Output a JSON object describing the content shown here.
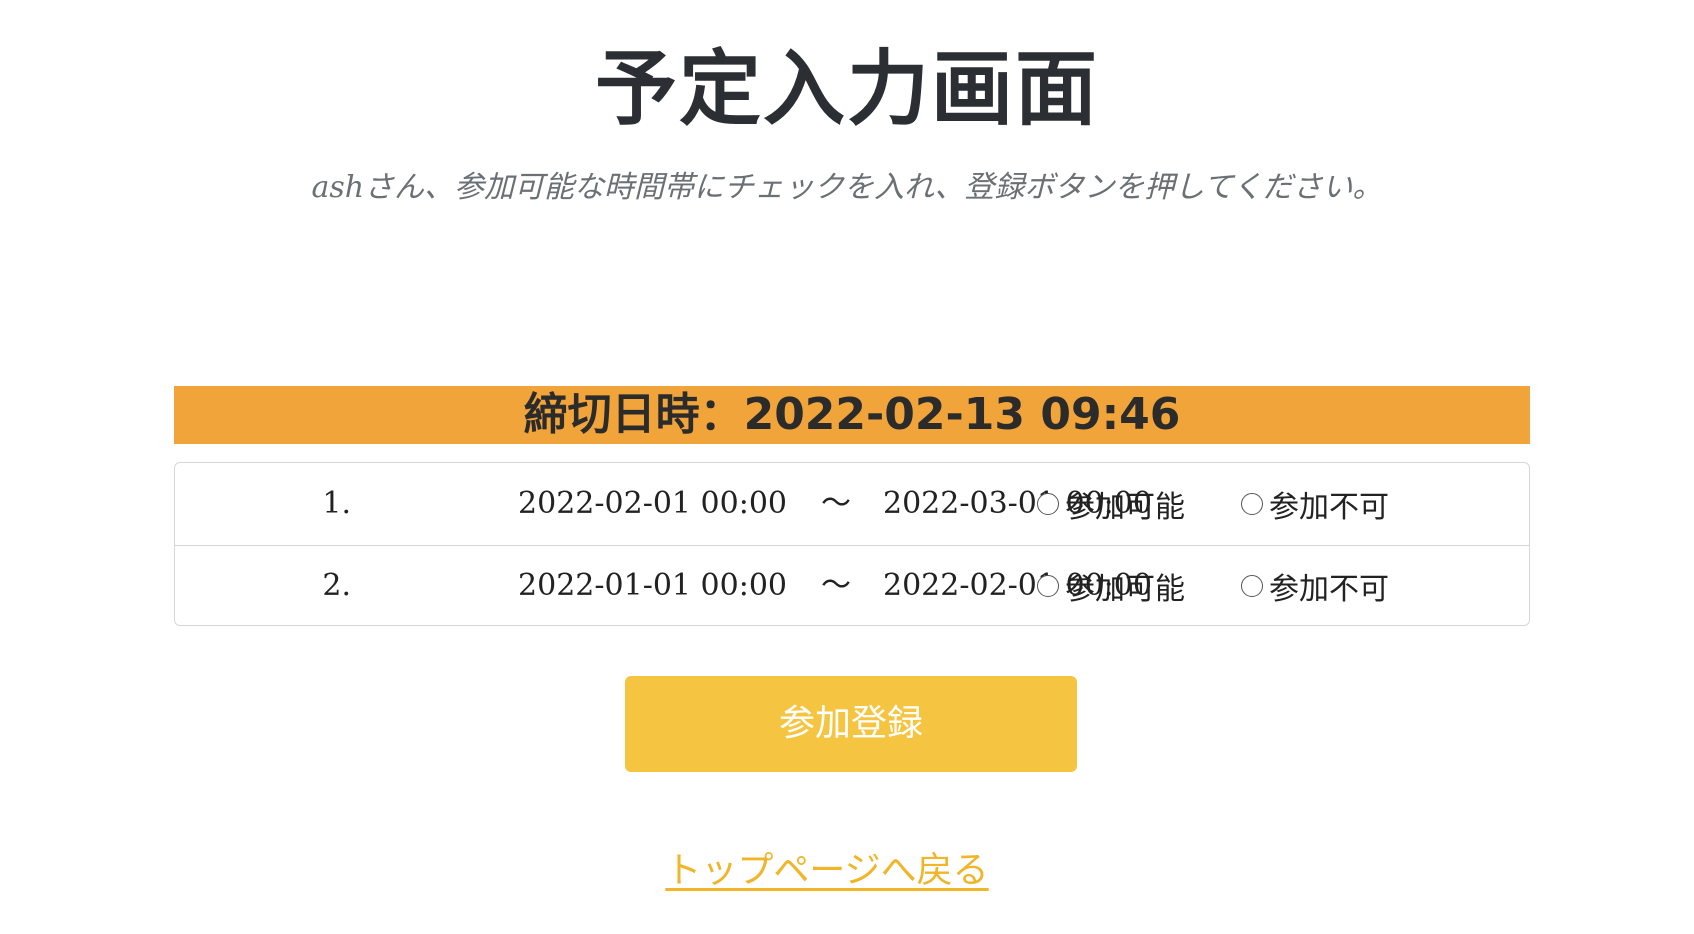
{
  "page": {
    "title": "予定入力画面",
    "subtitle": "ashさん、参加可能な時間帯にチェックを入れ、登録ボタンを押してください。"
  },
  "deadline": {
    "label": "締切日時：2022-02-13 09:46"
  },
  "schedule": {
    "rows": [
      {
        "number": "1.",
        "start": "2022-02-01 00:00",
        "separator": "〜",
        "end": "2022-03-01 00:00",
        "option_yes": "参加可能",
        "option_no": "参加不可",
        "selected": null
      },
      {
        "number": "2.",
        "start": "2022-01-01 00:00",
        "separator": "〜",
        "end": "2022-02-01 00:00",
        "option_yes": "参加可能",
        "option_no": "参加不可",
        "selected": null
      }
    ]
  },
  "actions": {
    "submit_label": "参加登録",
    "back_link_label": "トップページへ戻る"
  },
  "colors": {
    "deadline_bg": "#f0a43a",
    "button_bg": "#f5c542",
    "link": "#f0b529"
  }
}
